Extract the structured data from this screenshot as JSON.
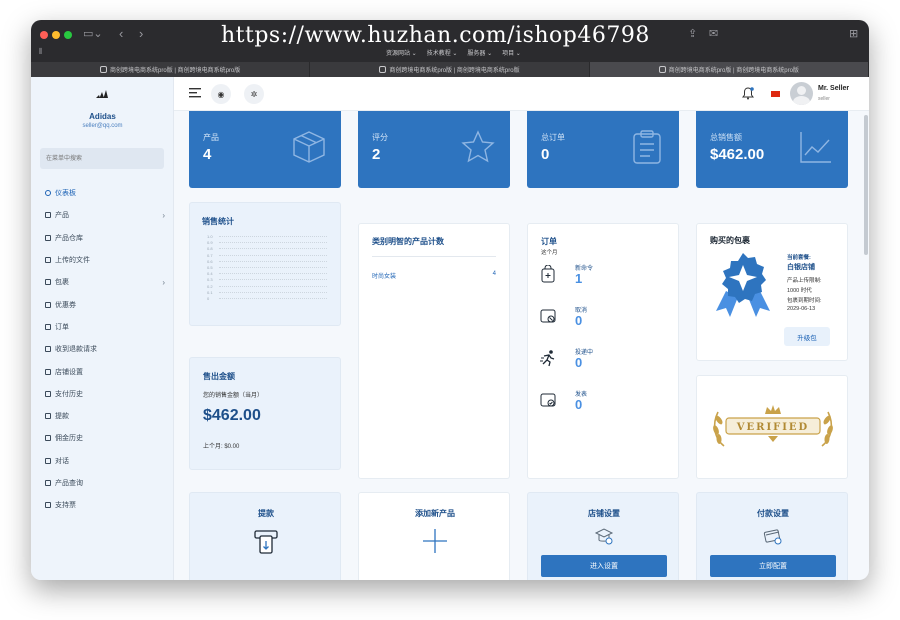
{
  "browser": {
    "url_overlay": "https://www.huzhan.com/ishop46798",
    "menu_items": [
      "资源网站 ⌄",
      "技术教程 ⌄",
      "服务器 ⌄",
      "项目 ⌄"
    ],
    "tabs": [
      {
        "label": "商创跨境电商系统pro版 | 商创跨境电商系统pro版"
      },
      {
        "label": "商创跨境电商系统pro版 | 商创跨境电商系统pro版"
      },
      {
        "label": "商创跨境电商系统pro版 | 商创跨境电商系统pro版"
      }
    ]
  },
  "sidebar": {
    "brand_name": "Adidas",
    "brand_email": "seller@qq.com",
    "search_placeholder": "在菜单中搜索",
    "items": [
      {
        "label": "仪表板",
        "icon": "home-icon",
        "active": true,
        "has_children": false
      },
      {
        "label": "产品",
        "icon": "cart-icon",
        "active": false,
        "has_children": true
      },
      {
        "label": "产品仓库",
        "icon": "warehouse-icon",
        "active": false,
        "has_children": false
      },
      {
        "label": "上传的文件",
        "icon": "file-icon",
        "active": false,
        "has_children": false
      },
      {
        "label": "包裹",
        "icon": "package-icon",
        "active": false,
        "has_children": true
      },
      {
        "label": "优惠券",
        "icon": "coupon-icon",
        "active": false,
        "has_children": false
      },
      {
        "label": "订单",
        "icon": "order-icon",
        "active": false,
        "has_children": false
      },
      {
        "label": "收到退款请求",
        "icon": "refund-icon",
        "active": false,
        "has_children": false
      },
      {
        "label": "店铺设置",
        "icon": "shop-icon",
        "active": false,
        "has_children": false
      },
      {
        "label": "支付历史",
        "icon": "history-icon",
        "active": false,
        "has_children": false
      },
      {
        "label": "提款",
        "icon": "withdraw-icon",
        "active": false,
        "has_children": false
      },
      {
        "label": "佣金历史",
        "icon": "commission-icon",
        "active": false,
        "has_children": false
      },
      {
        "label": "对话",
        "icon": "chat-icon",
        "active": false,
        "has_children": false
      },
      {
        "label": "产品查询",
        "icon": "query-icon",
        "active": false,
        "has_children": false
      },
      {
        "label": "支持票",
        "icon": "ticket-icon",
        "active": false,
        "has_children": false
      }
    ]
  },
  "header": {
    "user_name": "Mr. Seller",
    "user_role": "seller"
  },
  "stats": [
    {
      "label": "产品",
      "value": "4",
      "icon": "box-icon"
    },
    {
      "label": "评分",
      "value": "2",
      "icon": "star-icon"
    },
    {
      "label": "总订单",
      "value": "0",
      "icon": "clipboard-icon"
    },
    {
      "label": "总销售额",
      "value": "$462.00",
      "icon": "chart-line-icon"
    }
  ],
  "sales_stats": {
    "title": "销售统计",
    "ticks": [
      "1.0",
      "0.9",
      "0.8",
      "0.7",
      "0.6",
      "0.5",
      "0.4",
      "0.3",
      "0.2",
      "0.1",
      "0"
    ]
  },
  "category_count": {
    "title": "类别明智的产品计数",
    "rows": [
      {
        "name": "时尚女装",
        "count": "4"
      }
    ]
  },
  "orders": {
    "title": "订单",
    "subtitle": "这个月",
    "rows": [
      {
        "label": "新命令",
        "value": "1"
      },
      {
        "label": "取消",
        "value": "0"
      },
      {
        "label": "投递中",
        "value": "0"
      },
      {
        "label": "发表",
        "value": "0"
      }
    ]
  },
  "package": {
    "title": "购买的包裹",
    "current_label": "当前套餐:",
    "current_name": "白银店铺",
    "limit_line1": "产品上传限制:",
    "limit_line2": "1000 时代",
    "expiry_label": "包裹到期时间:",
    "expiry_date": "2029-06-13",
    "upgrade_label": "升级包"
  },
  "verified": {
    "text": "VERIFIED"
  },
  "sold_amount": {
    "title": "售出金额",
    "subtitle": "您的销售金额（当月）",
    "amount": "$462.00",
    "last_month": "上个月: $0.00"
  },
  "actions": [
    {
      "title": "提款",
      "icon": "withdraw-icon",
      "button": ""
    },
    {
      "title": "添加新产品",
      "icon": "plus-icon",
      "button": ""
    },
    {
      "title": "店铺设置",
      "icon": "shop-settings-icon",
      "button": "进入设置"
    },
    {
      "title": "付款设置",
      "icon": "card-icon",
      "button": "立即配置"
    }
  ],
  "colors": {
    "primary": "#2e74bf",
    "sidebar_bg": "#eef4fb",
    "gold": "#c9a24a"
  }
}
